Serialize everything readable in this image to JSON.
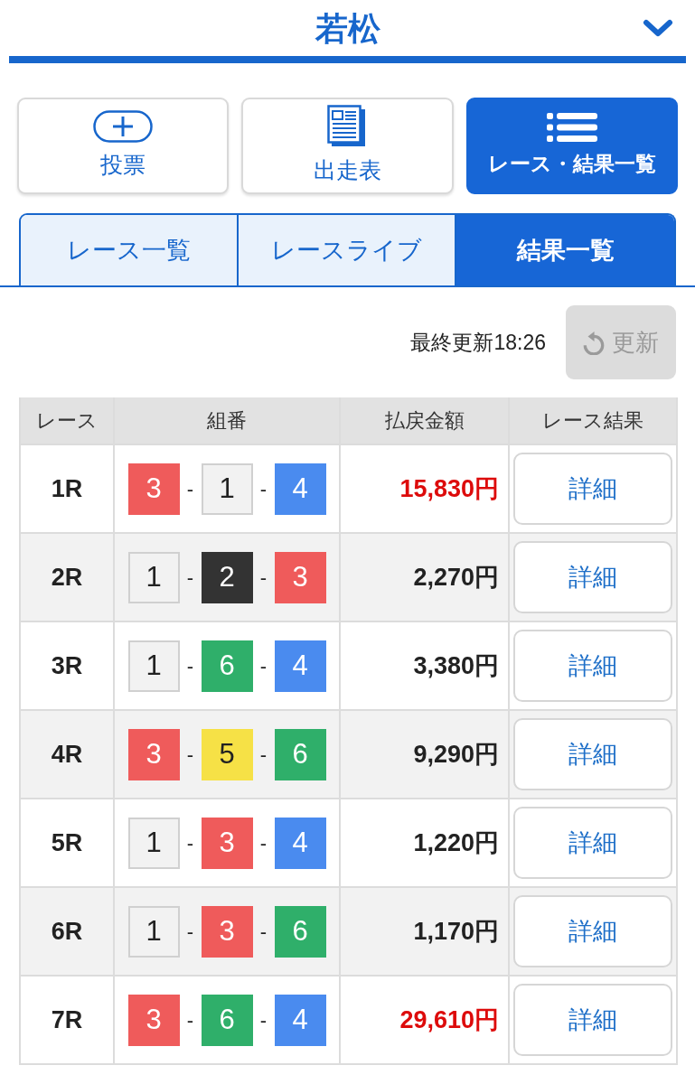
{
  "header": {
    "title": "若松",
    "dropdown": {
      "expanded": false
    }
  },
  "nav_buttons": [
    {
      "label": "投票",
      "selected": false
    },
    {
      "label": "出走表",
      "selected": false
    },
    {
      "label": "レース・結果一覧",
      "selected": true
    }
  ],
  "tabs": [
    {
      "label": "レース一覧",
      "selected": false
    },
    {
      "label": "レースライブ",
      "selected": false
    },
    {
      "label": "結果一覧",
      "selected": true
    }
  ],
  "update": {
    "last_updated": "最終更新18:26",
    "refresh_button": {
      "label": "更新",
      "disabled": true
    }
  },
  "table": {
    "columns": [
      "レース",
      "組番",
      "払戻金額",
      "レース結果"
    ],
    "rows": [
      {
        "race": "1R",
        "combination": [
          {
            "kind": "boat",
            "number": "3",
            "color": "#ef5b5b"
          },
          {
            "kind": "dash",
            "text": "-"
          },
          {
            "kind": "boat",
            "number": "1",
            "color": "#f2f2f2"
          },
          {
            "kind": "dash",
            "text": "-"
          },
          {
            "kind": "boat",
            "number": "4",
            "color": "#4a8bef"
          }
        ],
        "payout": "15,830円",
        "highlight": true,
        "detail_button": "詳細"
      },
      {
        "race": "2R",
        "combination": [
          {
            "kind": "boat",
            "number": "1",
            "color": "#f2f2f2"
          },
          {
            "kind": "dash",
            "text": "-"
          },
          {
            "kind": "boat",
            "number": "2",
            "color": "#333333"
          },
          {
            "kind": "dash",
            "text": "-"
          },
          {
            "kind": "boat",
            "number": "3",
            "color": "#ef5b5b"
          }
        ],
        "payout": "2,270円",
        "highlight": false,
        "detail_button": "詳細"
      },
      {
        "race": "3R",
        "combination": [
          {
            "kind": "boat",
            "number": "1",
            "color": "#f2f2f2"
          },
          {
            "kind": "dash",
            "text": "-"
          },
          {
            "kind": "boat",
            "number": "6",
            "color": "#2faf6a"
          },
          {
            "kind": "dash",
            "text": "-"
          },
          {
            "kind": "boat",
            "number": "4",
            "color": "#4a8bef"
          }
        ],
        "payout": "3,380円",
        "highlight": false,
        "detail_button": "詳細"
      },
      {
        "race": "4R",
        "combination": [
          {
            "kind": "boat",
            "number": "3",
            "color": "#ef5b5b"
          },
          {
            "kind": "dash",
            "text": "-"
          },
          {
            "kind": "boat",
            "number": "5",
            "color": "#f6e146"
          },
          {
            "kind": "dash",
            "text": "-"
          },
          {
            "kind": "boat",
            "number": "6",
            "color": "#2faf6a"
          }
        ],
        "payout": "9,290円",
        "highlight": false,
        "detail_button": "詳細"
      },
      {
        "race": "5R",
        "combination": [
          {
            "kind": "boat",
            "number": "1",
            "color": "#f2f2f2"
          },
          {
            "kind": "dash",
            "text": "-"
          },
          {
            "kind": "boat",
            "number": "3",
            "color": "#ef5b5b"
          },
          {
            "kind": "dash",
            "text": "-"
          },
          {
            "kind": "boat",
            "number": "4",
            "color": "#4a8bef"
          }
        ],
        "payout": "1,220円",
        "highlight": false,
        "detail_button": "詳細"
      },
      {
        "race": "6R",
        "combination": [
          {
            "kind": "boat",
            "number": "1",
            "color": "#f2f2f2"
          },
          {
            "kind": "dash",
            "text": "-"
          },
          {
            "kind": "boat",
            "number": "3",
            "color": "#ef5b5b"
          },
          {
            "kind": "dash",
            "text": "-"
          },
          {
            "kind": "boat",
            "number": "6",
            "color": "#2faf6a"
          }
        ],
        "payout": "1,170円",
        "highlight": false,
        "detail_button": "詳細"
      },
      {
        "race": "7R",
        "combination": [
          {
            "kind": "boat",
            "number": "3",
            "color": "#ef5b5b"
          },
          {
            "kind": "dash",
            "text": "-"
          },
          {
            "kind": "boat",
            "number": "6",
            "color": "#2faf6a"
          },
          {
            "kind": "dash",
            "text": "-"
          },
          {
            "kind": "boat",
            "number": "4",
            "color": "#4a8bef"
          }
        ],
        "payout": "29,610円",
        "highlight": true,
        "detail_button": "詳細"
      }
    ]
  }
}
